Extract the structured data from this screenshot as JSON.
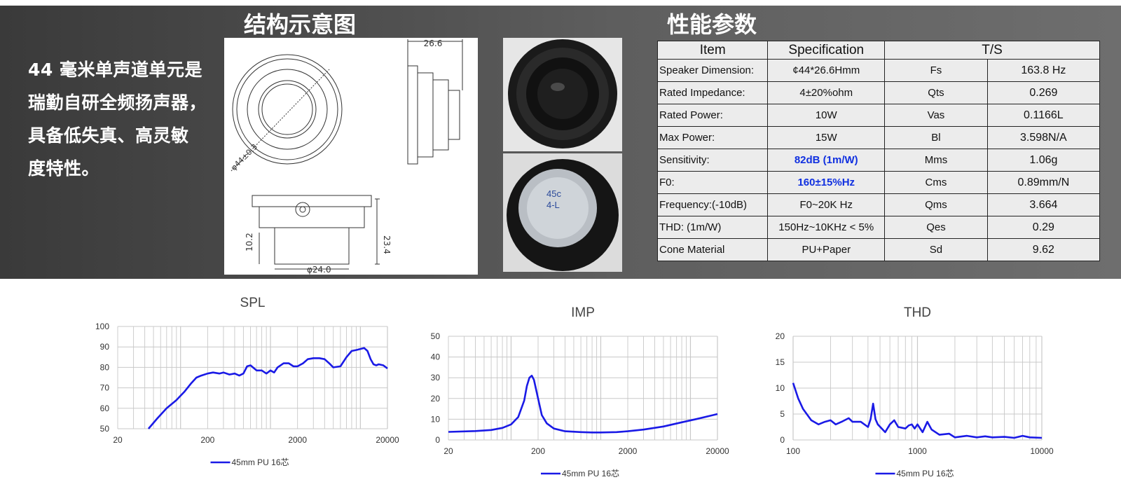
{
  "intro_text": [
    "44 毫米单声道单元是",
    "瑞勤自研全频扬声器，",
    "具备低失真、高灵敏",
    "度特性。"
  ],
  "section_titles": {
    "structure": "结构示意图",
    "performance": "性能参数"
  },
  "drawing_labels": {
    "width_dim": "26.6",
    "diameter_dim": "φ44±0.3",
    "height_dim": "23.4",
    "magnet_height": "10.2",
    "magnet_dia": "φ24.0"
  },
  "photo_label": "45c\n4-L",
  "spec_table": {
    "headers": [
      "Item",
      "Specification",
      "T/S"
    ],
    "rows": [
      {
        "item": "Speaker Dimension:",
        "spec": "¢44*26.6Hmm",
        "param": "Fs",
        "value": "163.8 Hz",
        "highlight": false
      },
      {
        "item": "Rated Impedance:",
        "spec": "4±20%ohm",
        "param": "Qts",
        "value": "0.269",
        "highlight": false
      },
      {
        "item": "Rated Power:",
        "spec": "10W",
        "param": "Vas",
        "value": "0.1166L",
        "highlight": false
      },
      {
        "item": "Max Power:",
        "spec": "15W",
        "param": "Bl",
        "value": "3.598N/A",
        "highlight": false
      },
      {
        "item": "Sensitivity:",
        "spec": "82dB (1m/W)",
        "param": "Mms",
        "value": "1.06g",
        "highlight": true
      },
      {
        "item": "F0:",
        "spec": "160±15%Hz",
        "param": "Cms",
        "value": "0.89mm/N",
        "highlight": true
      },
      {
        "item": "Frequency:(-10dB)",
        "spec": "F0~20K Hz",
        "param": "Qms",
        "value": "3.664",
        "highlight": false
      },
      {
        "item": "THD: (1m/W)",
        "spec": "150Hz~10KHz < 5%",
        "param": "Qes",
        "value": "0.29",
        "highlight": false
      },
      {
        "item": "Cone  Material",
        "spec": "PU+Paper",
        "param": "Sd",
        "value": "9.62",
        "highlight": false
      }
    ]
  },
  "colors": {
    "series": "#1a1ae6",
    "highlight_text": "#1030e0",
    "grid": "#c8c8c8"
  },
  "chart_data": [
    {
      "type": "line",
      "title": "SPL",
      "xscale": "log",
      "xlim": [
        20,
        20000
      ],
      "ylim": [
        50,
        100
      ],
      "xticks": [
        20,
        200,
        2000,
        20000
      ],
      "xtick_labels": [
        "20",
        "200",
        "2000",
        "20000"
      ],
      "yticks": [
        50,
        60,
        70,
        80,
        90,
        100
      ],
      "ytick_labels": [
        "50",
        "60",
        "70",
        "80",
        "90",
        "100"
      ],
      "legend": "bottom",
      "series": [
        {
          "name": "45mm PU 16芯",
          "x": [
            44,
            55,
            70,
            90,
            110,
            130,
            150,
            170,
            200,
            230,
            270,
            300,
            350,
            400,
            450,
            500,
            550,
            600,
            700,
            800,
            900,
            1000,
            1100,
            1200,
            1400,
            1600,
            1800,
            2000,
            2300,
            2600,
            3000,
            3500,
            4000,
            4500,
            5000,
            6000,
            7000,
            8000,
            9000,
            10000,
            11000,
            12000,
            13000,
            14000,
            15000,
            16000,
            18000,
            20000
          ],
          "y": [
            50,
            55,
            60,
            64,
            68,
            72,
            75,
            76,
            77,
            77.5,
            77,
            77.5,
            76.5,
            77,
            76,
            77,
            80.5,
            81,
            78.5,
            78.5,
            77,
            78.5,
            77.5,
            80,
            82,
            82,
            80.5,
            80.5,
            82,
            84,
            84.5,
            84.5,
            84,
            82,
            80,
            80.5,
            85,
            88,
            88.5,
            89,
            89.5,
            88,
            84,
            81.5,
            81,
            81.5,
            81,
            79.5
          ]
        }
      ]
    },
    {
      "type": "line",
      "title": "IMP",
      "xscale": "log",
      "xlim": [
        20,
        20000
      ],
      "ylim": [
        0,
        50
      ],
      "xticks": [
        20,
        200,
        2000,
        20000
      ],
      "xtick_labels": [
        "20",
        "200",
        "2000",
        "20000"
      ],
      "yticks": [
        0,
        10,
        20,
        30,
        40,
        50
      ],
      "ytick_labels": [
        "0",
        "10",
        "20",
        "30",
        "40",
        "50"
      ],
      "legend": "bottom",
      "series": [
        {
          "name": "45mm PU 16芯",
          "x": [
            20,
            40,
            60,
            80,
            100,
            120,
            140,
            150,
            160,
            170,
            180,
            200,
            220,
            250,
            300,
            400,
            600,
            800,
            1000,
            1500,
            2000,
            3000,
            5000,
            8000,
            12000,
            20000
          ],
          "y": [
            3.9,
            4.3,
            4.8,
            5.8,
            7.5,
            11,
            19,
            26,
            30,
            31,
            29,
            20,
            12,
            8,
            5.5,
            4.2,
            3.8,
            3.6,
            3.6,
            3.8,
            4.2,
            5,
            6.5,
            8.5,
            10.2,
            12.5
          ]
        }
      ]
    },
    {
      "type": "line",
      "title": "THD",
      "xscale": "log",
      "xlim": [
        100,
        10000
      ],
      "ylim": [
        0,
        20
      ],
      "xticks": [
        100,
        1000,
        10000
      ],
      "xtick_labels": [
        "100",
        "1000",
        "10000"
      ],
      "yticks": [
        0,
        5,
        10,
        15,
        20
      ],
      "ytick_labels": [
        "0",
        "5",
        "10",
        "15",
        "20"
      ],
      "legend": "bottom",
      "series": [
        {
          "name": "45mm PU 16芯",
          "x": [
            100,
            110,
            120,
            140,
            160,
            180,
            200,
            220,
            250,
            280,
            300,
            350,
            400,
            420,
            440,
            460,
            480,
            550,
            600,
            650,
            700,
            800,
            850,
            900,
            950,
            1000,
            1100,
            1200,
            1300,
            1500,
            1800,
            2000,
            2500,
            3000,
            3500,
            4000,
            5000,
            6000,
            7000,
            8000,
            10000
          ],
          "y": [
            11,
            8,
            6,
            3.8,
            3,
            3.5,
            3.8,
            3,
            3.6,
            4.2,
            3.5,
            3.5,
            2.5,
            4,
            7,
            4,
            3,
            1.5,
            3,
            3.8,
            2.5,
            2.2,
            2.8,
            3,
            2.2,
            3,
            1.5,
            3.5,
            2,
            1,
            1.2,
            0.5,
            0.8,
            0.5,
            0.7,
            0.5,
            0.6,
            0.4,
            0.8,
            0.5,
            0.4
          ]
        }
      ]
    }
  ]
}
